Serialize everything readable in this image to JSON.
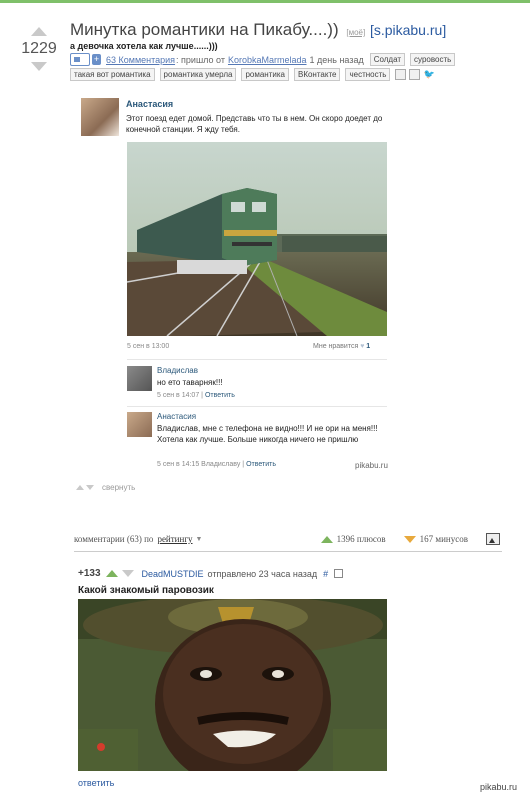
{
  "post": {
    "score": "1229",
    "title": "Минутка романтики на Пикабу....))",
    "mine_label": "[моё]",
    "source": "s.pikabu.ru",
    "subtitle": "а девочка хотела как лучше......)))",
    "comments_link": "63 Комментария",
    "posted_by_prefix": ": пришло от",
    "author": "KorobkaMarmelada",
    "posted_time": "1 день назад",
    "tags_row1": [
      "Солдат",
      "суровость"
    ],
    "tags_row2": [
      "такая вот романтика",
      "романтика умерла",
      "романтика",
      "ВКонтакте",
      "честность"
    ],
    "share_icons": [
      "image-icon",
      "link-icon",
      "twitter-icon"
    ]
  },
  "vk": {
    "name": "Анастасия",
    "text": "Этот поезд едет домой. Представь что ты в нем. Он скоро доедет до конечной станции. Я жду тебя.",
    "date": "5 сен в 13:00",
    "like_label": "Мне нравится",
    "like_count": "1",
    "replies": [
      {
        "name": "Владислав",
        "text": "но ето таварняк!!!",
        "date": "5 сен в 14:07",
        "action": "Ответить"
      },
      {
        "name": "Анастасия",
        "text": "Владислав, мне с телефона не видно!!! И не ори на меня!!! Хотела как лучше. Больше никогда ничего не пришлю",
        "date": "5 сен в 14:15 Владиславу",
        "action": "Ответить"
      }
    ],
    "watermark": "pikabu.ru",
    "collapse_label": "свернуть"
  },
  "comments_bar": {
    "label": "комментарии (63) по",
    "sort": "рейтингу",
    "pluses": "1396 плюсов",
    "minuses": "167 минусов"
  },
  "comment": {
    "score": "+133",
    "user": "DeadMUSTDIE",
    "time": "отправлено 23 часа назад",
    "hash": "#",
    "text": "Какой знакомый паровозик",
    "answer": "ответить"
  },
  "footer_watermark": "pikabu.ru"
}
